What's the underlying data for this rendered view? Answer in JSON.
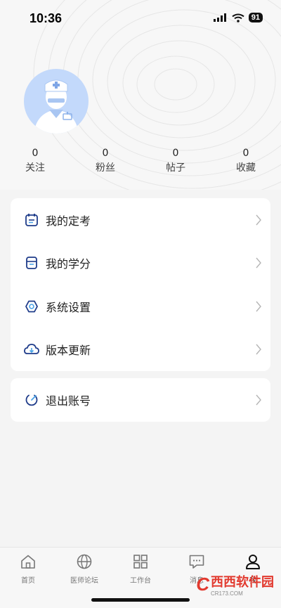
{
  "status_bar": {
    "time": "10:36",
    "battery": "91"
  },
  "profile": {
    "avatar_name": "doctor-avatar"
  },
  "stats": [
    {
      "value": "0",
      "label": "关注"
    },
    {
      "value": "0",
      "label": "粉丝"
    },
    {
      "value": "0",
      "label": "帖子"
    },
    {
      "value": "0",
      "label": "收藏"
    }
  ],
  "menu": {
    "items": [
      {
        "label": "我的定考",
        "icon": "calendar-icon"
      },
      {
        "label": "我的学分",
        "icon": "notebook-icon"
      },
      {
        "label": "系统设置",
        "icon": "settings-hex-icon"
      },
      {
        "label": "版本更新",
        "icon": "cloud-download-icon"
      }
    ],
    "logout": {
      "label": "退出账号",
      "icon": "power-icon"
    }
  },
  "tabbar": {
    "items": [
      {
        "label": "首页",
        "icon": "home-icon"
      },
      {
        "label": "医师论坛",
        "icon": "globe-icon"
      },
      {
        "label": "工作台",
        "icon": "grid-icon"
      },
      {
        "label": "消息",
        "icon": "message-icon"
      },
      {
        "label": "我",
        "icon": "user-icon"
      }
    ],
    "active": "我"
  },
  "watermark": {
    "logo": "C",
    "brand": "西西软件园",
    "sub": "CR173.COM"
  },
  "colors": {
    "accent": "#1f3c8a",
    "avatar_bg": "#c3d9fb",
    "card": "#ffffff",
    "page": "#f4f4f4"
  }
}
